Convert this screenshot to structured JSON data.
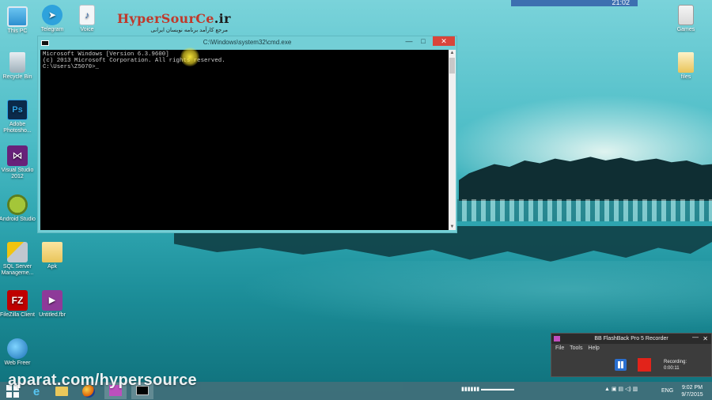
{
  "desktop": {
    "icons_left": [
      {
        "label": "This PC"
      },
      {
        "label": "Recycle Bin"
      },
      {
        "label": "Adobe Photosho..."
      },
      {
        "label": "Visual Studio 2012"
      },
      {
        "label": "Android Studio"
      },
      {
        "label": "SQL Server Manageme..."
      },
      {
        "label": "FileZilla Client"
      },
      {
        "label": "Web Freer"
      }
    ],
    "icons_mid": [
      {
        "label": "Telegram"
      },
      {
        "label": "Voice"
      },
      {
        "label": "Apk"
      },
      {
        "label": "Untitled.fbr"
      }
    ],
    "icons_right": [
      {
        "label": "Games"
      },
      {
        "label": "files"
      }
    ],
    "clock_top": "21:02"
  },
  "banner": {
    "brand_red": "HyperSourCe",
    "brand_dark": ".ir",
    "tagline": "مرجع کارآمد برنامه نویسان ایرانی"
  },
  "cmd_window": {
    "title": "C:\\Windows\\system32\\cmd.exe",
    "min_label": "—",
    "max_label": "□",
    "close_label": "✕",
    "lines": [
      "Microsoft Windows [Version 6.3.9600]",
      "(c) 2013 Microsoft Corporation. All rights reserved.",
      "",
      "C:\\Users\\Z5070>_"
    ]
  },
  "recorder": {
    "title": "BB FlashBack Pro 5 Recorder",
    "menu": [
      "File",
      "Tools",
      "Help"
    ],
    "status_label": "Recording:",
    "status_time": "0:00:11",
    "close_label": "✕",
    "min_label": "—"
  },
  "taskbar": {
    "watermark": "aparat.com/hypersource",
    "language": "ENG",
    "time": "9:02 PM",
    "date": "9/7/2015"
  },
  "colors": {
    "cmd_bg": "#000000",
    "close_red": "#d9453a",
    "brand_red": "#c0392b",
    "record_red": "#e2231a",
    "pause_blue": "#2a6fd0"
  }
}
